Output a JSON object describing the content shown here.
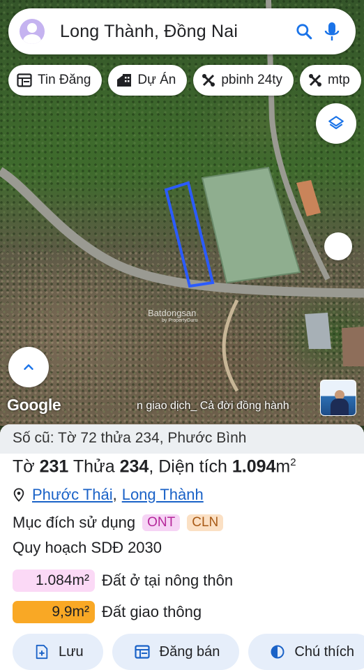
{
  "search": {
    "text": "Long Thành, Đồng Nai"
  },
  "chips": [
    {
      "label": "Tin Đăng",
      "icon": "listing-icon"
    },
    {
      "label": "Dự Án",
      "icon": "building-icon"
    },
    {
      "label": "pbinh 24ty",
      "icon": "tools-icon"
    },
    {
      "label": "mtp",
      "icon": "tools-icon"
    }
  ],
  "map": {
    "logo": "Google",
    "ticker": "n giao dịch_ Cả đời đồng hành",
    "watermark": "Batdongsan",
    "watermark_sub": "by PropertyGuru"
  },
  "sheet": {
    "old_record": "Số cũ: Tờ 72 thửa 234, Phước Bình",
    "sheet_label": "Tờ",
    "sheet_no": "231",
    "plot_label": "Thửa",
    "plot_no": "234",
    "area_label": ", Diện tích",
    "area_value": "1.094",
    "area_unit": "m",
    "area_sup": "2",
    "ward": "Phước Thái",
    "separator": ",",
    "district": "Long Thành",
    "purpose_label": "Mục đích sử dụng",
    "purpose_tags": [
      {
        "code": "ONT",
        "bg": "#f6d4f5",
        "color": "#b5279a"
      },
      {
        "code": "CLN",
        "bg": "#fbe0c4",
        "color": "#a85a16"
      }
    ],
    "plan_title": "Quy hoạch SDĐ 2030",
    "plan_rows": [
      {
        "area": "1.084m²",
        "desc": "Đất ở tại nông thôn",
        "bg": "#fbd9f6",
        "color": "#202124"
      },
      {
        "area": "9,9m²",
        "desc": "Đất giao thông",
        "bg": "#f9a825",
        "color": "#202124"
      }
    ]
  },
  "actions": {
    "save": "Lưu",
    "post": "Đăng bán",
    "note": "Chú thích"
  },
  "colors": {
    "accent": "#1a73e8",
    "parcel_outline": "#2b5bff"
  }
}
